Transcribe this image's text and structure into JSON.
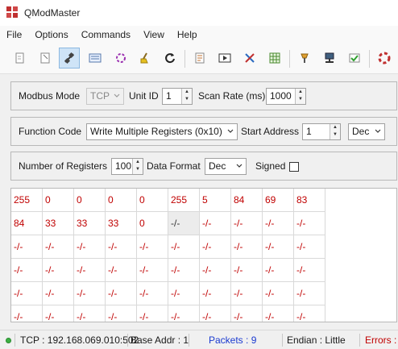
{
  "window": {
    "title": "QModMaster"
  },
  "menu": [
    "File",
    "Options",
    "Commands",
    "View",
    "Help"
  ],
  "toolbar": [
    {
      "name": "connect-icon",
      "glyph": "⎘"
    },
    {
      "name": "save-icon",
      "glyph": "🗎"
    },
    {
      "name": "plug-icon",
      "glyph": "🔌"
    },
    {
      "name": "read-write-icon",
      "glyph": "▤"
    },
    {
      "name": "scan-icon",
      "glyph": "⟳"
    },
    {
      "name": "clear-icon",
      "glyph": "✎"
    },
    {
      "name": "refresh-icon",
      "glyph": "↻"
    },
    {
      "name": "log-icon",
      "glyph": "📄"
    },
    {
      "name": "monitor-icon",
      "glyph": "▶"
    },
    {
      "name": "tools-icon",
      "glyph": "✕"
    },
    {
      "name": "table-icon",
      "glyph": "▦"
    },
    {
      "name": "bus-monitor-icon",
      "glyph": "⚙"
    },
    {
      "name": "network-icon",
      "glyph": "⌂"
    },
    {
      "name": "check-icon",
      "glyph": "✓"
    },
    {
      "name": "help-icon",
      "glyph": "◉"
    }
  ],
  "settings": {
    "modbus_mode_label": "Modbus Mode",
    "modbus_mode_value": "TCP",
    "unit_id_label": "Unit ID",
    "unit_id_value": "1",
    "scan_rate_label": "Scan Rate (ms)",
    "scan_rate_value": "1000",
    "function_code_label": "Function Code",
    "function_code_value": "Write Multiple Registers (0x10)",
    "start_address_label": "Start Address",
    "start_address_value": "1",
    "start_address_format": "Dec",
    "num_registers_label": "Number of Registers",
    "num_registers_value": "100",
    "data_format_label": "Data Format",
    "data_format_value": "Dec",
    "signed_label": "Signed",
    "signed_checked": false
  },
  "registers": [
    [
      "255",
      "0",
      "0",
      "0",
      "0",
      "255",
      "5",
      "84",
      "69",
      "83"
    ],
    [
      "84",
      "33",
      "33",
      "33",
      "0",
      "-/-",
      "-/-",
      "-/-",
      "-/-",
      "-/-"
    ],
    [
      "-/-",
      "-/-",
      "-/-",
      "-/-",
      "-/-",
      "-/-",
      "-/-",
      "-/-",
      "-/-",
      "-/-"
    ],
    [
      "-/-",
      "-/-",
      "-/-",
      "-/-",
      "-/-",
      "-/-",
      "-/-",
      "-/-",
      "-/-",
      "-/-"
    ],
    [
      "-/-",
      "-/-",
      "-/-",
      "-/-",
      "-/-",
      "-/-",
      "-/-",
      "-/-",
      "-/-",
      "-/-"
    ],
    [
      "-/-",
      "-/-",
      "-/-",
      "-/-",
      "-/-",
      "-/-",
      "-/-",
      "-/-",
      "-/-",
      "-/-"
    ]
  ],
  "status": {
    "connection": "TCP : 192.168.069.010:502",
    "base_addr": "Base Addr : 1",
    "packets": "Packets : 9",
    "endian": "Endian : Little",
    "errors": "Errors :"
  },
  "colors": {
    "value_red": "#c00000",
    "packets_blue": "#1a3ad0",
    "status_led": "#3cb043"
  }
}
